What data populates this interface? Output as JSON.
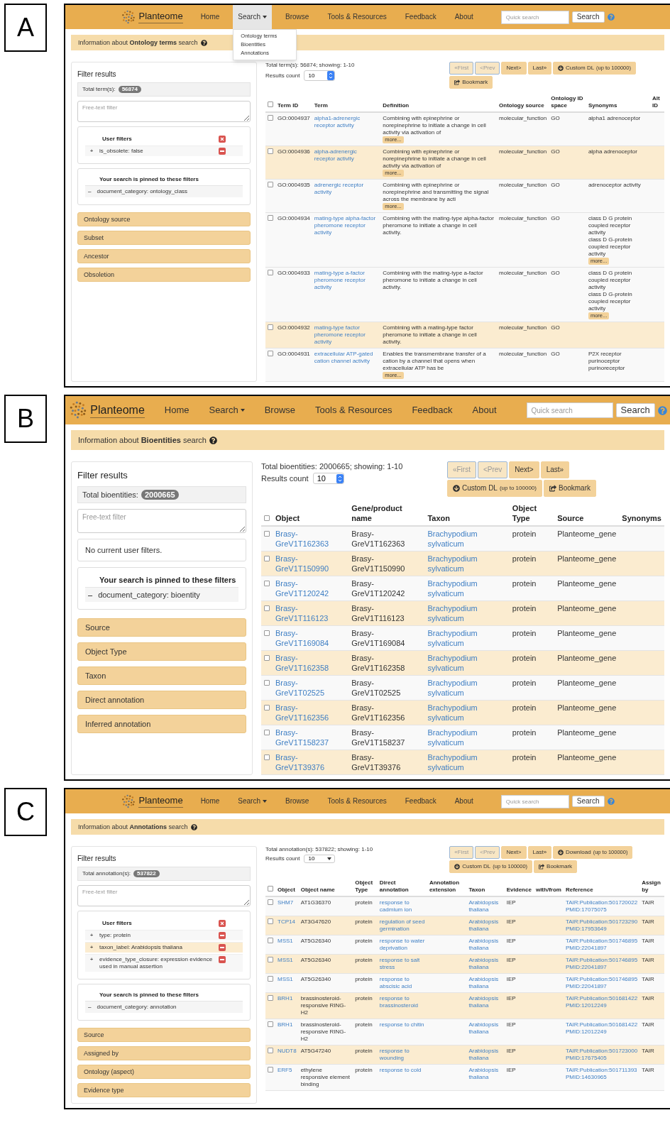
{
  "panels": [
    {
      "letter": "A",
      "nav": {
        "logo": "Planteome",
        "items": [
          {
            "label": "Home",
            "selected": false,
            "dropdown": false
          },
          {
            "label": "Search",
            "selected": true,
            "dropdown": true,
            "menu": [
              "Ontology terms",
              "Bioentities",
              "Annotations"
            ]
          },
          {
            "label": "Browse",
            "selected": false,
            "dropdown": false
          },
          {
            "label": "Tools & Resources",
            "selected": false,
            "dropdown": false
          },
          {
            "label": "Feedback",
            "selected": false,
            "dropdown": false
          },
          {
            "label": "About",
            "selected": false,
            "dropdown": false
          }
        ],
        "quick_search": {
          "placeholder": "Quick search"
        },
        "search_button": "Search"
      },
      "info": "Information about **Ontology terms** search",
      "sidebar": {
        "title": "Filter results",
        "total": {
          "label": "Total term(s):",
          "badge": "56874"
        },
        "filter": {
          "placeholder": "Free-text filter"
        },
        "user_filters": {
          "kind": "list",
          "title": "User filters",
          "items": [
            {
              "sign": "+",
              "text": "is_obsolete: false",
              "highlighted": false
            }
          ]
        },
        "pinned": {
          "title": "Your search is pinned to these filters",
          "items": [
            {
              "sign": "–",
              "text": "document_category: ontology_class"
            }
          ]
        },
        "facets": [
          "Ontology source",
          "Subset",
          "Ancestor",
          "Obsoletion"
        ]
      },
      "results": {
        "all_checked": false,
        "summary": "Total term(s): 56874; showing: 1-10",
        "count": {
          "label": "Results count",
          "value": "10",
          "kind": "spinner"
        },
        "buttons": [
          {
            "label": "«First",
            "disabled": true,
            "kind": "page"
          },
          {
            "label": "<Prev",
            "disabled": true,
            "kind": "page"
          },
          {
            "label": "Next>",
            "disabled": false,
            "kind": "page"
          },
          {
            "label": "Last»",
            "disabled": false,
            "kind": "page"
          },
          {
            "label": "Custom DL",
            "note": "(up to 100000)",
            "disabled": false,
            "kind": "download"
          },
          {
            "label": "Bookmark",
            "disabled": false,
            "kind": "bookmark"
          }
        ],
        "columns": [
          {
            "label": "Term ID",
            "kind": "text"
          },
          {
            "label": "Term",
            "kind": "link"
          },
          {
            "label": "Definition",
            "kind": "text"
          },
          {
            "label": "Ontology source",
            "kind": "text"
          },
          {
            "label": "Ontology ID space",
            "kind": "text"
          },
          {
            "label": "Synonyms",
            "kind": "text"
          },
          {
            "label": "Alt ID",
            "kind": "text"
          }
        ],
        "rows": [
          {
            "checked": false,
            "highlighted": false,
            "cells": [
              "GO:0004937",
              "alpha1-adrenergic receptor activity",
              {
                "text": "Combining with epinephrine or norepinephrine to initiate a change in cell activity via activation of",
                "more": "more..."
              },
              "molecular_function",
              "GO",
              "alpha1 adrenoceptor",
              ""
            ]
          },
          {
            "checked": false,
            "highlighted": true,
            "cells": [
              "GO:0004936",
              "alpha-adrenergic receptor activity",
              {
                "text": "Combining with epinephrine or norepinephrine to initiate a change in cell activity via activation of",
                "more": "more..."
              },
              "molecular_function",
              "GO",
              "alpha adrenoceptor",
              ""
            ]
          },
          {
            "checked": false,
            "highlighted": false,
            "cells": [
              "GO:0004935",
              "adrenergic receptor activity",
              {
                "text": "Combining with epinephrine or norepinephrine and transmitting the signal across the membrane by acti",
                "more": "more..."
              },
              "molecular_function",
              "GO",
              "adrenoceptor activity",
              ""
            ]
          },
          {
            "checked": false,
            "highlighted": false,
            "cells": [
              "GO:0004934",
              "mating-type alpha-factor pheromone receptor activity",
              "Combining with the mating-type alpha-factor pheromone to initiate a change in cell activity.",
              "molecular_function",
              "GO",
              {
                "text": [
                  "class D G protein coupled receptor activity",
                  "class D G-protein coupled receptor activity"
                ],
                "more": "more..."
              },
              ""
            ]
          },
          {
            "checked": false,
            "highlighted": false,
            "cells": [
              "GO:0004933",
              "mating-type a-factor pheromone receptor activity",
              "Combining with the mating-type a-factor pheromone to initiate a change in cell activity.",
              "molecular_function",
              "GO",
              {
                "text": [
                  "class D G protein coupled receptor activity",
                  "class D G-protein coupled receptor activity"
                ],
                "more": "more..."
              },
              ""
            ]
          },
          {
            "checked": false,
            "highlighted": true,
            "cells": [
              "GO:0004932",
              "mating-type factor pheromone receptor activity",
              "Combining with a mating-type factor pheromone to initiate a change in cell activity.",
              "molecular_function",
              "GO",
              "",
              ""
            ]
          },
          {
            "checked": false,
            "highlighted": false,
            "cells": [
              "GO:0004931",
              "extracellular ATP-gated cation channel activity",
              {
                "text": "Enables the transmembrane transfer of a cation by a channel that opens when extracellular ATP has be",
                "more": "more..."
              },
              "molecular_function",
              "GO",
              [
                "P2X receptor",
                "purinoceptor",
                "purinoreceptor"
              ],
              ""
            ]
          }
        ]
      }
    },
    {
      "letter": "B",
      "nav": {
        "logo": "Planteome",
        "items": [
          {
            "label": "Home",
            "selected": false,
            "dropdown": false
          },
          {
            "label": "Search",
            "selected": false,
            "dropdown": true
          },
          {
            "label": "Browse",
            "selected": false,
            "dropdown": false
          },
          {
            "label": "Tools & Resources",
            "selected": false,
            "dropdown": false
          },
          {
            "label": "Feedback",
            "selected": false,
            "dropdown": false
          },
          {
            "label": "About",
            "selected": false,
            "dropdown": false
          }
        ],
        "quick_search": {
          "placeholder": "Quick search"
        },
        "search_button": "Search"
      },
      "info": "Information about **Bioentities** search",
      "sidebar": {
        "title": "Filter results",
        "total": {
          "label": "Total bioentities:",
          "badge": "2000665"
        },
        "filter": {
          "placeholder": "Free-text filter"
        },
        "user_filters": {
          "kind": "empty",
          "message": "No current user filters."
        },
        "pinned": {
          "title": "Your search is pinned to these filters",
          "items": [
            {
              "sign": "–",
              "text": "document_category: bioentity"
            }
          ]
        },
        "facets": [
          "Source",
          "Object Type",
          "Taxon",
          "Direct annotation",
          "Inferred annotation"
        ]
      },
      "results": {
        "all_checked": false,
        "summary": "Total bioentities: 2000665; showing: 1-10",
        "count": {
          "label": "Results count",
          "value": "10",
          "kind": "spinner"
        },
        "buttons": [
          {
            "label": "«First",
            "disabled": true,
            "kind": "page"
          },
          {
            "label": "<Prev",
            "disabled": true,
            "kind": "page"
          },
          {
            "label": "Next>",
            "disabled": false,
            "kind": "page"
          },
          {
            "label": "Last»",
            "disabled": false,
            "kind": "page"
          },
          {
            "label": "Custom DL",
            "note": "(up to 100000)",
            "disabled": false,
            "kind": "download"
          },
          {
            "label": "Bookmark",
            "disabled": false,
            "kind": "bookmark"
          }
        ],
        "columns": [
          {
            "label": "Object",
            "kind": "link"
          },
          {
            "label": "Gene/product name",
            "kind": "text"
          },
          {
            "label": "Taxon",
            "kind": "link"
          },
          {
            "label": "Object Type",
            "kind": "text"
          },
          {
            "label": "Source",
            "kind": "text"
          },
          {
            "label": "Synonyms",
            "kind": "text"
          }
        ],
        "rows": [
          {
            "checked": false,
            "highlighted": false,
            "cells": [
              "Brasy-GreV1T162363",
              "Brasy-GreV1T162363",
              "Brachypodium sylvaticum",
              "protein",
              "Planteome_gene",
              ""
            ]
          },
          {
            "checked": false,
            "highlighted": true,
            "cells": [
              "Brasy-GreV1T150990",
              "Brasy-GreV1T150990",
              "Brachypodium sylvaticum",
              "protein",
              "Planteome_gene",
              ""
            ]
          },
          {
            "checked": false,
            "highlighted": false,
            "cells": [
              "Brasy-GreV1T120242",
              "Brasy-GreV1T120242",
              "Brachypodium sylvaticum",
              "protein",
              "Planteome_gene",
              ""
            ]
          },
          {
            "checked": false,
            "highlighted": true,
            "cells": [
              "Brasy-GreV1T116123",
              "Brasy-GreV1T116123",
              "Brachypodium sylvaticum",
              "protein",
              "Planteome_gene",
              ""
            ]
          },
          {
            "checked": false,
            "highlighted": false,
            "cells": [
              "Brasy-GreV1T169084",
              "Brasy-GreV1T169084",
              "Brachypodium sylvaticum",
              "protein",
              "Planteome_gene",
              ""
            ]
          },
          {
            "checked": false,
            "highlighted": true,
            "cells": [
              "Brasy-GreV1T162358",
              "Brasy-GreV1T162358",
              "Brachypodium sylvaticum",
              "protein",
              "Planteome_gene",
              ""
            ]
          },
          {
            "checked": false,
            "highlighted": false,
            "cells": [
              "Brasy-GreV1T02525",
              "Brasy-GreV1T02525",
              "Brachypodium sylvaticum",
              "protein",
              "Planteome_gene",
              ""
            ]
          },
          {
            "checked": false,
            "highlighted": true,
            "cells": [
              "Brasy-GreV1T162356",
              "Brasy-GreV1T162356",
              "Brachypodium sylvaticum",
              "protein",
              "Planteome_gene",
              ""
            ]
          },
          {
            "checked": false,
            "highlighted": false,
            "cells": [
              "Brasy-GreV1T158237",
              "Brasy-GreV1T158237",
              "Brachypodium sylvaticum",
              "protein",
              "Planteome_gene",
              ""
            ]
          },
          {
            "checked": false,
            "highlighted": true,
            "cells": [
              "Brasy-GreV1T39376",
              "Brasy-GreV1T39376",
              "Brachypodium sylvaticum",
              "protein",
              "Planteome_gene",
              ""
            ]
          }
        ]
      }
    },
    {
      "letter": "C",
      "nav": {
        "logo": "Planteome",
        "items": [
          {
            "label": "Home",
            "selected": false,
            "dropdown": false
          },
          {
            "label": "Search",
            "selected": false,
            "dropdown": true
          },
          {
            "label": "Browse",
            "selected": false,
            "dropdown": false
          },
          {
            "label": "Tools & Resources",
            "selected": false,
            "dropdown": false
          },
          {
            "label": "Feedback",
            "selected": false,
            "dropdown": false
          },
          {
            "label": "About",
            "selected": false,
            "dropdown": false
          }
        ],
        "quick_search": {
          "placeholder": "Quick search"
        },
        "search_button": "Search"
      },
      "info": "Information about **Annotations** search",
      "sidebar": {
        "title": "Filter results",
        "total": {
          "label": "Total annotation(s):",
          "badge": "537822"
        },
        "filter": {
          "placeholder": "Free-text filter"
        },
        "user_filters": {
          "kind": "list",
          "title": "User filters",
          "items": [
            {
              "sign": "+",
              "text": "type: protein",
              "highlighted": false
            },
            {
              "sign": "+",
              "text": "taxon_label: Arabidopsis thaliana",
              "highlighted": true
            },
            {
              "sign": "+",
              "text": "evidence_type_closure: expression evidence used in manual assertion",
              "highlighted": false
            }
          ]
        },
        "pinned": {
          "title": "Your search is pinned to these filters",
          "items": [
            {
              "sign": "–",
              "text": "document_category: annotation"
            }
          ]
        },
        "facets": [
          "Source",
          "Assigned by",
          "Ontology (aspect)",
          "Evidence type"
        ]
      },
      "results": {
        "all_checked": false,
        "summary": "Total annotation(s): 537822; showing: 1-10",
        "count": {
          "label": "Results count",
          "value": "10",
          "kind": "dropdown"
        },
        "buttons": [
          {
            "label": "«First",
            "disabled": true,
            "kind": "page"
          },
          {
            "label": "<Prev",
            "disabled": true,
            "kind": "page"
          },
          {
            "label": "Next>",
            "disabled": false,
            "kind": "page"
          },
          {
            "label": "Last»",
            "disabled": false,
            "kind": "page"
          },
          {
            "label": "Download",
            "note": "(up to 100000)",
            "disabled": false,
            "kind": "download"
          },
          {
            "label": "Custom DL",
            "note": "(up to 100000)",
            "disabled": false,
            "kind": "download"
          },
          {
            "label": "Bookmark",
            "disabled": false,
            "kind": "bookmark"
          }
        ],
        "columns": [
          {
            "label": "Object",
            "kind": "link"
          },
          {
            "label": "Object name",
            "kind": "text"
          },
          {
            "label": "Object Type",
            "kind": "text"
          },
          {
            "label": "Direct annotation",
            "kind": "link"
          },
          {
            "label": "Annotation extension",
            "kind": "text"
          },
          {
            "label": "Taxon",
            "kind": "link"
          },
          {
            "label": "Evidence",
            "kind": "text"
          },
          {
            "label": "with/from",
            "kind": "text"
          },
          {
            "label": "Reference",
            "kind": "link"
          },
          {
            "label": "Assign by",
            "kind": "text"
          }
        ],
        "rows": [
          {
            "checked": false,
            "highlighted": false,
            "cells": [
              "SHM7",
              "AT1G36370",
              "protein",
              "response to cadmium ion",
              "",
              "Arabidopsis thaliana",
              "IEP",
              "",
              [
                "TAIR:Publication:501720022",
                "PMID:17075075"
              ],
              "TAIR"
            ]
          },
          {
            "checked": false,
            "highlighted": true,
            "cells": [
              "TCP14",
              "AT3G47620",
              "protein",
              "regulation of seed germination",
              "",
              "Arabidopsis thaliana",
              "IEP",
              "",
              [
                "TAIR:Publication:501723290",
                "PMID:17953649"
              ],
              "TAIR"
            ]
          },
          {
            "checked": false,
            "highlighted": false,
            "cells": [
              "MSS1",
              "AT5G26340",
              "protein",
              "response to water deprivation",
              "",
              "Arabidopsis thaliana",
              "IEP",
              "",
              [
                "TAIR:Publication:501746895",
                "PMID:22041897"
              ],
              "TAIR"
            ]
          },
          {
            "checked": false,
            "highlighted": true,
            "cells": [
              "MSS1",
              "AT5G26340",
              "protein",
              "response to salt stress",
              "",
              "Arabidopsis thaliana",
              "IEP",
              "",
              [
                "TAIR:Publication:501746895",
                "PMID:22041897"
              ],
              "TAIR"
            ]
          },
          {
            "checked": false,
            "highlighted": false,
            "cells": [
              "MSS1",
              "AT5G26340",
              "protein",
              "response to abscisic acid",
              "",
              "Arabidopsis thaliana",
              "IEP",
              "",
              [
                "TAIR:Publication:501746895",
                "PMID:22041897"
              ],
              "TAIR"
            ]
          },
          {
            "checked": false,
            "highlighted": true,
            "cells": [
              "BRH1",
              "brassinosteroid-responsive RING-H2",
              "protein",
              "response to brassinosteroid",
              "",
              "Arabidopsis thaliana",
              "IEP",
              "",
              [
                "TAIR:Publication:501681422",
                "PMID:12012249"
              ],
              "TAIR"
            ]
          },
          {
            "checked": false,
            "highlighted": false,
            "cells": [
              "BRH1",
              "brassinosteroid-responsive RING-H2",
              "protein",
              "response to chitin",
              "",
              "Arabidopsis thaliana",
              "IEP",
              "",
              [
                "TAIR:Publication:501681422",
                "PMID:12012249"
              ],
              "TAIR"
            ]
          },
          {
            "checked": false,
            "highlighted": true,
            "cells": [
              "NUDT8",
              "AT5G47240",
              "protein",
              "response to wounding",
              "",
              "Arabidopsis thaliana",
              "IEP",
              "",
              [
                "TAIR:Publication:501723000",
                "PMID:17675405"
              ],
              "TAIR"
            ]
          },
          {
            "checked": false,
            "highlighted": false,
            "cells": [
              "ERF5",
              "ethylene responsive element binding",
              "protein",
              "response to cold",
              "",
              "Arabidopsis thaliana",
              "IEP",
              "",
              [
                "TAIR:Publication:501711393",
                "PMID:14630965"
              ],
              "TAIR"
            ]
          }
        ]
      }
    }
  ]
}
